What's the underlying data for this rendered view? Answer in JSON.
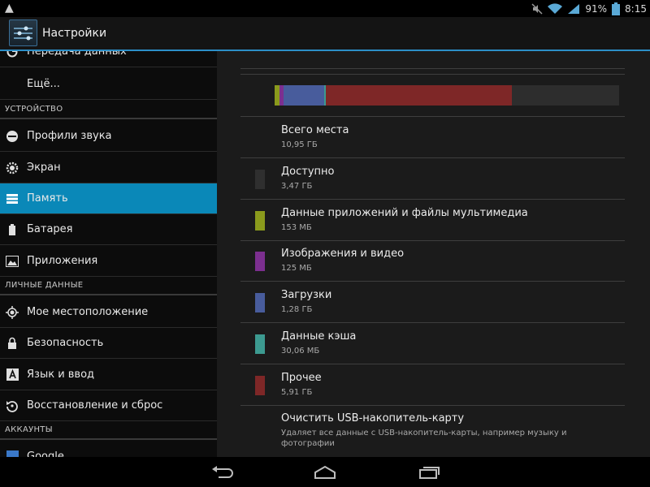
{
  "status_bar": {
    "warning_icon": "warning-icon",
    "battery_percent": "91%",
    "time": "8:15",
    "icons": [
      "mute-icon",
      "wifi-icon",
      "signal-icon",
      "battery-icon"
    ]
  },
  "action_bar": {
    "app_icon": "settings-app-icon",
    "title": "Настройки"
  },
  "sidebar": {
    "items_top": [
      {
        "label": "Передача данных",
        "icon": "data-usage-icon"
      },
      {
        "label": "Ещё...",
        "icon": ""
      }
    ],
    "section_device": "УСТРОЙСТВО",
    "items_device": [
      {
        "label": "Профили звука",
        "icon": "sound-icon"
      },
      {
        "label": "Экран",
        "icon": "display-icon"
      },
      {
        "label": "Память",
        "icon": "storage-icon",
        "selected": true
      },
      {
        "label": "Батарея",
        "icon": "battery-icon"
      },
      {
        "label": "Приложения",
        "icon": "apps-icon"
      }
    ],
    "section_personal": "ЛИЧНЫЕ ДАННЫЕ",
    "items_personal": [
      {
        "label": "Мое местоположение",
        "icon": "location-icon"
      },
      {
        "label": "Безопасность",
        "icon": "lock-icon"
      },
      {
        "label": "Язык и ввод",
        "icon": "language-icon"
      },
      {
        "label": "Восстановление и сброс",
        "icon": "backup-icon"
      }
    ],
    "section_accounts": "АККАУНТЫ",
    "items_accounts": [
      {
        "label": "Google",
        "icon": "google-icon"
      }
    ]
  },
  "storage": {
    "usage_bar": [
      {
        "name": "Данные приложений и файлы мультимедиа",
        "fraction": 0.0137,
        "color": "#8a9a1c"
      },
      {
        "name": "Изображения и видео",
        "fraction": 0.0112,
        "color": "#7c2f8f"
      },
      {
        "name": "Загрузки",
        "fraction": 0.117,
        "color": "#485c9c"
      },
      {
        "name": "Данные кэша",
        "fraction": 0.0027,
        "color": "#3c9a90"
      },
      {
        "name": "Прочее",
        "fraction": 0.54,
        "color": "#7e2727"
      }
    ],
    "usage_bar_free_color": "#2d2d2d",
    "rows": [
      {
        "title": "Всего места",
        "value": "10,95 ГБ",
        "color": ""
      },
      {
        "title": "Доступно",
        "value": "3,47 ГБ",
        "color": "#2f2f2f"
      },
      {
        "title": "Данные приложений и файлы мультимедиа",
        "value": "153 МБ",
        "color": "#8a9a1c"
      },
      {
        "title": "Изображения и видео",
        "value": "125 МБ",
        "color": "#7c2f8f"
      },
      {
        "title": "Загрузки",
        "value": "1,28 ГБ",
        "color": "#485c9c"
      },
      {
        "title": "Данные кэша",
        "value": "30,06 МБ",
        "color": "#3c9a90"
      },
      {
        "title": "Прочее",
        "value": "5,91 ГБ",
        "color": "#7e2727"
      }
    ],
    "clear": {
      "title": "Очистить USB-накопитель-карту",
      "description": "Удаляет все данные с USB-накопитель-карты, например музыку и фотографии"
    }
  },
  "nav_bar": {
    "icons": [
      "back-icon",
      "home-icon",
      "recent-apps-icon"
    ]
  },
  "colors": {
    "accent": "#0a88b8",
    "action_bar_line": "#2c8fc8"
  }
}
